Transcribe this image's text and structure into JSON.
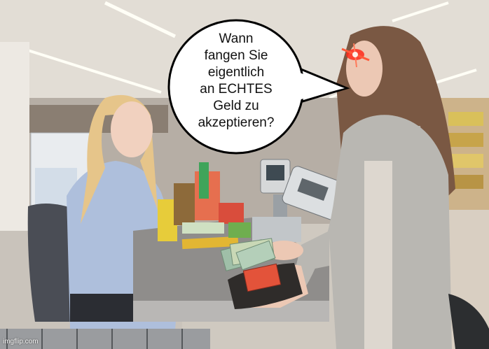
{
  "meme": {
    "speech_bubble": {
      "lines": [
        "Wann",
        "fangen Sie",
        "eigentlich",
        "an ECHTES",
        "Geld zu",
        "akzeptieren?"
      ]
    },
    "watermark": "imgflip.com"
  },
  "colors": {
    "laser_eyes": "#ff2a1a",
    "cashier_shirt": "#aebfdc",
    "customer_cardigan": "#b9b7b2",
    "banknotes": "#9fbfa8",
    "card": "#e3533a"
  }
}
